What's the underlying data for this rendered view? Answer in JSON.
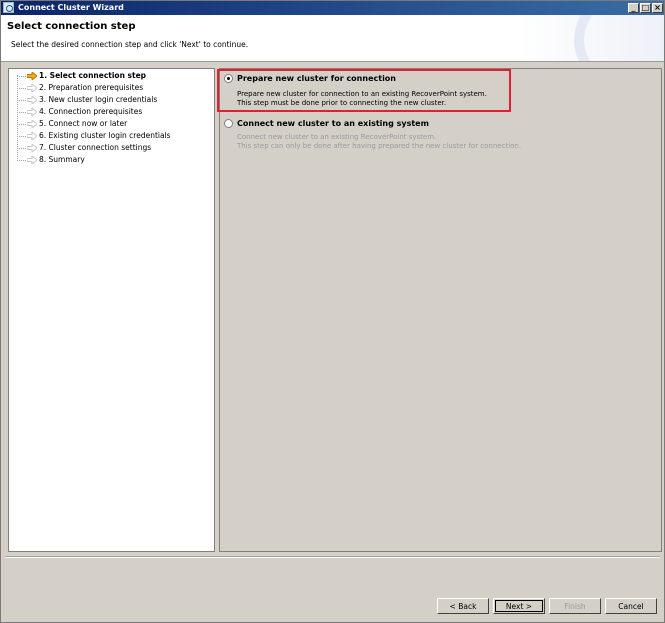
{
  "window": {
    "title": "Connect Cluster Wizard",
    "controls": [
      "_",
      "□",
      "×"
    ]
  },
  "header": {
    "title": "Select connection step",
    "subtitle": "Select the desired connection step and click 'Next' to continue."
  },
  "steps": [
    {
      "label": "1. Select connection step",
      "current": true
    },
    {
      "label": "2. Preparation prerequisites",
      "current": false
    },
    {
      "label": "3. New cluster login credentials",
      "current": false
    },
    {
      "label": "4. Connection prerequisites",
      "current": false
    },
    {
      "label": "5. Connect now or later",
      "current": false
    },
    {
      "label": "6. Existing cluster login credentials",
      "current": false
    },
    {
      "label": "7. Cluster connection settings",
      "current": false
    },
    {
      "label": "8. Summary",
      "current": false
    }
  ],
  "options": [
    {
      "title": "Prepare new cluster for connection",
      "desc1": "Prepare new cluster for connection to an existing RecoverPoint system.",
      "desc2": "This step must be done prior to connecting the new cluster.",
      "selected": true
    },
    {
      "title": "Connect new cluster to an existing system",
      "desc1": "Connect new cluster to an existing RecoverPoint system.",
      "desc2": "This step can only be done after having prepared the new cluster for connection.",
      "selected": false
    }
  ],
  "buttons": {
    "back": "< Back",
    "next": "Next >",
    "finish": "Finish",
    "cancel": "Cancel"
  },
  "colors": {
    "current_arrow": "#f0b020",
    "arrow": "#c8c8c8",
    "highlight": "#e02030"
  }
}
